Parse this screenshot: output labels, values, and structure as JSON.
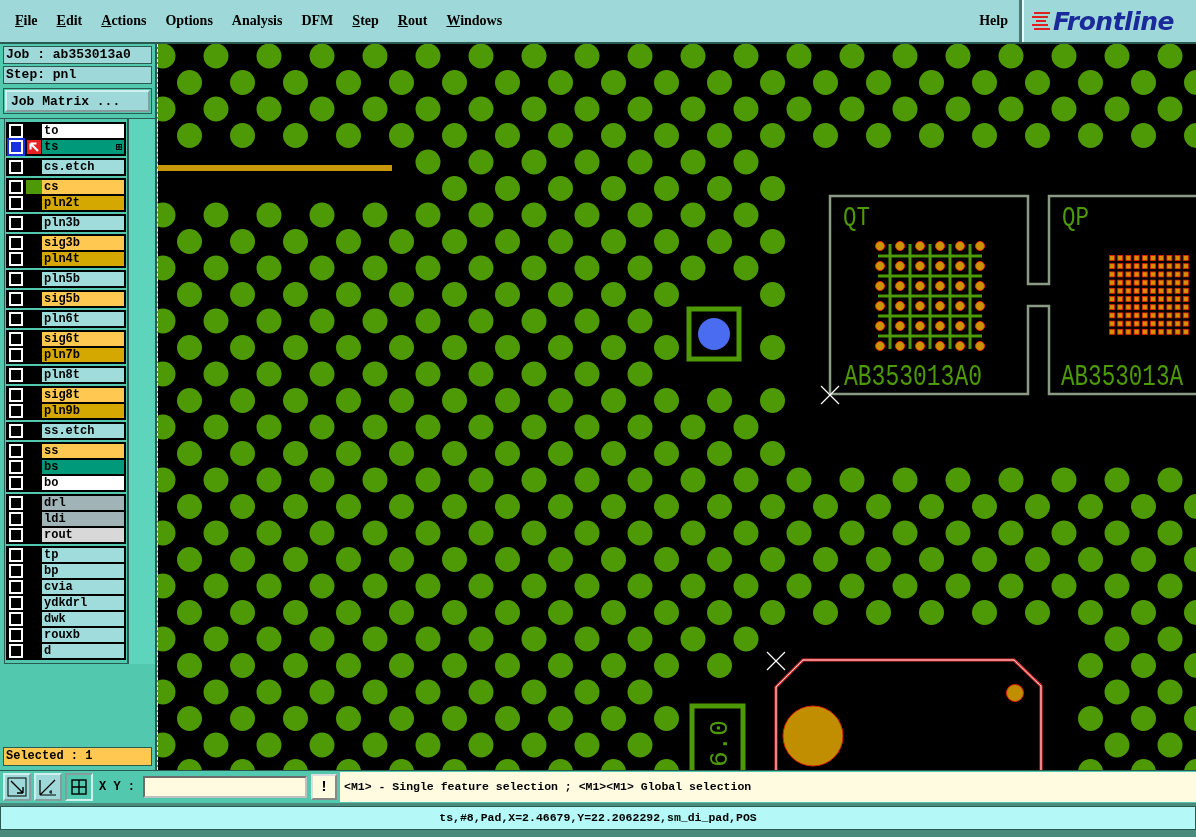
{
  "menu": [
    {
      "label": "File",
      "underlined": true
    },
    {
      "label": "Edit",
      "underlined": true
    },
    {
      "label": "Actions",
      "underlined": true
    },
    {
      "label": "Options",
      "underlined": false
    },
    {
      "label": "Analysis",
      "underlined": false
    },
    {
      "label": "DFM",
      "underlined": false
    },
    {
      "label": "Step",
      "underlined": true
    },
    {
      "label": "Rout",
      "underlined": true
    },
    {
      "label": "Windows",
      "underlined": true
    }
  ],
  "help": "Help",
  "logo": "Frontline",
  "job": "Job : ab353013a0",
  "step": "Step: pnl",
  "job_matrix_button": "Job Matrix ...",
  "layer_groups": [
    {
      "layers": [
        {
          "name": "to",
          "color": "#ffffff",
          "selected": false,
          "shown": false
        },
        {
          "name": "ts",
          "color": "#009a7a",
          "selected": true,
          "shown": false
        }
      ]
    },
    {
      "layers": [
        {
          "name": "cs.etch",
          "color": "#a0dcdc",
          "selected": false,
          "shown": false
        }
      ]
    },
    {
      "layers": [
        {
          "name": "cs",
          "color": "#ffc850",
          "selected": false,
          "shown": true
        },
        {
          "name": "pln2t",
          "color": "#d4a800",
          "selected": false,
          "shown": false
        }
      ]
    },
    {
      "layers": [
        {
          "name": "pln3b",
          "color": "#a0dcdc",
          "selected": false,
          "shown": false
        }
      ]
    },
    {
      "layers": [
        {
          "name": "sig3b",
          "color": "#ffc850",
          "selected": false,
          "shown": false
        },
        {
          "name": "pln4t",
          "color": "#d4a800",
          "selected": false,
          "shown": false
        }
      ]
    },
    {
      "layers": [
        {
          "name": "pln5b",
          "color": "#a0dcdc",
          "selected": false,
          "shown": false
        }
      ]
    },
    {
      "layers": [
        {
          "name": "sig5b",
          "color": "#ffc850",
          "selected": false,
          "shown": false
        }
      ]
    },
    {
      "layers": [
        {
          "name": "pln6t",
          "color": "#a0dcdc",
          "selected": false,
          "shown": false
        }
      ]
    },
    {
      "layers": [
        {
          "name": "sig6t",
          "color": "#ffc850",
          "selected": false,
          "shown": false
        },
        {
          "name": "pln7b",
          "color": "#d4a800",
          "selected": false,
          "shown": false
        }
      ]
    },
    {
      "layers": [
        {
          "name": "pln8t",
          "color": "#a0dcdc",
          "selected": false,
          "shown": false
        }
      ]
    },
    {
      "layers": [
        {
          "name": "sig8t",
          "color": "#ffc850",
          "selected": false,
          "shown": false
        },
        {
          "name": "pln9b",
          "color": "#d4a800",
          "selected": false,
          "shown": false
        }
      ]
    },
    {
      "layers": [
        {
          "name": "ss.etch",
          "color": "#a0dcdc",
          "selected": false,
          "shown": false
        }
      ]
    },
    {
      "layers": [
        {
          "name": "ss",
          "color": "#ffc850",
          "selected": false,
          "shown": false
        },
        {
          "name": "bs",
          "color": "#009a7a",
          "selected": false,
          "shown": false
        },
        {
          "name": "bo",
          "color": "#ffffff",
          "selected": false,
          "shown": false
        }
      ]
    },
    {
      "layers": [
        {
          "name": "drl",
          "color": "#a0b4b8",
          "selected": false,
          "shown": false
        },
        {
          "name": "ldi",
          "color": "#a0b4b8",
          "selected": false,
          "shown": false
        },
        {
          "name": "rout",
          "color": "#d8d8d8",
          "selected": false,
          "shown": false
        }
      ]
    },
    {
      "layers": [
        {
          "name": "tp",
          "color": "#a0dcdc",
          "selected": false,
          "shown": false
        },
        {
          "name": "bp",
          "color": "#a0dcdc",
          "selected": false,
          "shown": false
        },
        {
          "name": "cvia",
          "color": "#a0dcdc",
          "selected": false,
          "shown": false
        },
        {
          "name": "ydkdrl",
          "color": "#a0dcdc",
          "selected": false,
          "shown": false
        },
        {
          "name": "dwk",
          "color": "#a0dcdc",
          "selected": false,
          "shown": false
        },
        {
          "name": "rouxb",
          "color": "#a0dcdc",
          "selected": false,
          "shown": false
        },
        {
          "name": "d",
          "color": "#a0dcdc",
          "selected": false,
          "shown": false
        }
      ]
    }
  ],
  "selected_count": "Selected : 1",
  "toolbar": {
    "tools": [
      {
        "kind": "arrow",
        "selected": false
      },
      {
        "kind": "ruler",
        "selected": false
      },
      {
        "kind": "grid",
        "selected": true
      }
    ],
    "xy_label": "X Y :",
    "alert_button": "!",
    "hint": "<M1> - Single feature selection ; <M1><M1> Global selection"
  },
  "canvas": {
    "component_labels": [
      "QT",
      "QP"
    ],
    "part_numbers": [
      "AB353013A0",
      "AB353013A"
    ],
    "rotated_label": "6.0"
  },
  "status_bar": "ts,#8,Pad,X=2.46679,Y=22.2062292,sm_di_pad,POS"
}
